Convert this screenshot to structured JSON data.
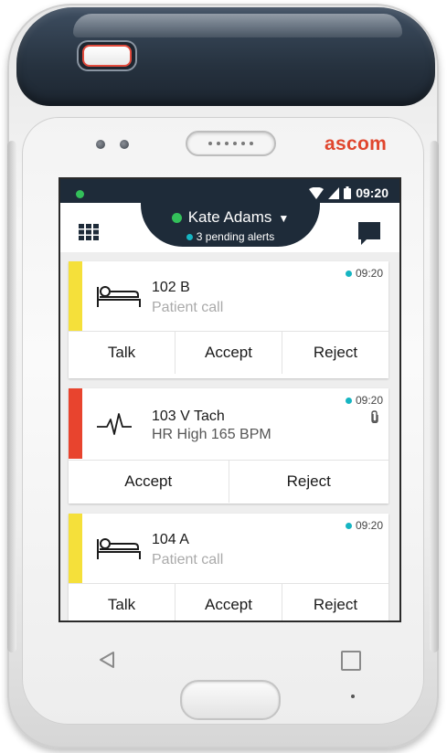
{
  "device": {
    "brand": "ascom",
    "brand_color": "#e0462e"
  },
  "statusbar": {
    "time": "09:20",
    "icons": [
      "notification-dot-icon",
      "wifi-icon",
      "signal-icon",
      "battery-icon"
    ]
  },
  "header": {
    "user_name": "Kate Adams",
    "presence_color": "#33c05a",
    "pending_alerts": "3 pending alerts",
    "menu_icon": "grid-menu-icon",
    "messages_icon": "chat-bubble-icon"
  },
  "alerts": [
    {
      "title": "102 B",
      "subtitle": "Patient call",
      "time": "09:20",
      "icon": "patient-bed-icon",
      "priority_color": "#f5e03a",
      "actions": [
        "Talk",
        "Accept",
        "Reject"
      ]
    },
    {
      "title": "103 V Tach",
      "subtitle": "HR High 165 BPM",
      "time": "09:20",
      "icon": "heartbeat-icon",
      "attachment_icon": "paperclip-icon",
      "priority_color": "#e8442e",
      "actions": [
        "Accept",
        "Reject"
      ]
    },
    {
      "title": "104 A",
      "subtitle": "Patient call",
      "time": "09:20",
      "icon": "patient-bed-icon",
      "priority_color": "#f5e03a",
      "actions": [
        "Talk",
        "Accept",
        "Reject"
      ]
    }
  ],
  "navigation": {
    "back_icon": "back-triangle-icon",
    "recent_icon": "recent-apps-icon",
    "home": "home-button"
  }
}
